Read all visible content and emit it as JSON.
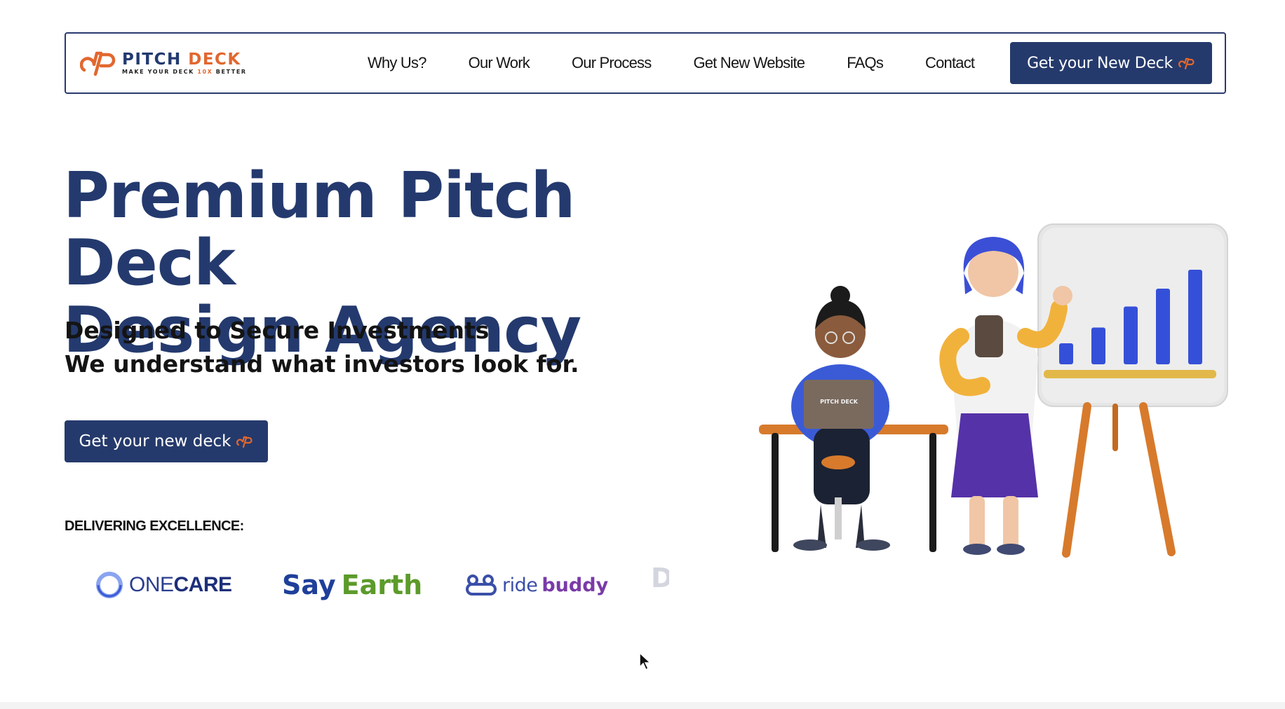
{
  "brand": {
    "name_part1": "PITCH",
    "name_part2": "DECK",
    "tagline_pre": "MAKE YOUR DECK ",
    "tagline_accent": "10X",
    "tagline_post": " BETTER",
    "colors": {
      "navy": "#243a6e",
      "orange": "#e2672f"
    }
  },
  "nav": {
    "items": [
      "Why Us?",
      "Our Work",
      "Our Process",
      "Get New Website",
      "FAQs",
      "Contact"
    ],
    "cta_label": "Get your New Deck"
  },
  "hero": {
    "title_line1": "Premium Pitch Deck",
    "title_line2": "Design Agency",
    "subtitle_line1": "Designed to Secure Investments",
    "subtitle_line2": "We understand what investors look for.",
    "cta_label": "Get your new deck"
  },
  "clients": {
    "heading": "DELIVERING EXCELLENCE:",
    "logos": [
      {
        "name_a": "ONE",
        "name_b": "CARE"
      },
      {
        "name_a": "Say",
        "name_b": "Earth"
      },
      {
        "name_a": "ride",
        "name_b": "buddy"
      },
      {
        "name_a": "D",
        "name_b": ""
      }
    ]
  },
  "illustration": {
    "laptop_label": "PITCH DECK",
    "board_bars": [
      0.2,
      0.35,
      0.55,
      0.72,
      0.9
    ]
  }
}
